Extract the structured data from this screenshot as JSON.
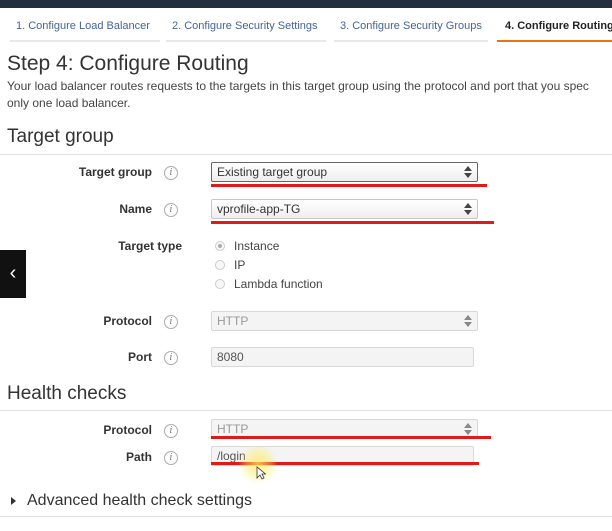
{
  "wizard": {
    "tabs": [
      {
        "label": "1. Configure Load Balancer"
      },
      {
        "label": "2. Configure Security Settings"
      },
      {
        "label": "3. Configure Security Groups"
      },
      {
        "label": "4. Configure Routing",
        "active": true
      }
    ],
    "accent_color": "#ec7211"
  },
  "page": {
    "title": "Step 4: Configure Routing",
    "description_line1": "Your load balancer routes requests to the targets in this target group using the protocol and port that you spec",
    "description_line2": "only one load balancer."
  },
  "target_group": {
    "section_title": "Target group",
    "target_group_label": "Target group",
    "target_group_value": "Existing target group",
    "name_label": "Name",
    "name_value": "vprofile-app-TG",
    "target_type_label": "Target type",
    "target_type_options": [
      "Instance",
      "IP",
      "Lambda function"
    ],
    "target_type_selected": "Instance",
    "protocol_label": "Protocol",
    "protocol_value": "HTTP",
    "port_label": "Port",
    "port_value": "8080"
  },
  "health_checks": {
    "section_title": "Health checks",
    "protocol_label": "Protocol",
    "protocol_value": "HTTP",
    "path_label": "Path",
    "path_value": "/login",
    "advanced_label": "Advanced health check settings"
  },
  "icons": {
    "info": "info-icon",
    "info_glyph": "i",
    "back": "chevron-left-icon",
    "back_glyph": "‹"
  },
  "annotation_color": "#e0191b"
}
